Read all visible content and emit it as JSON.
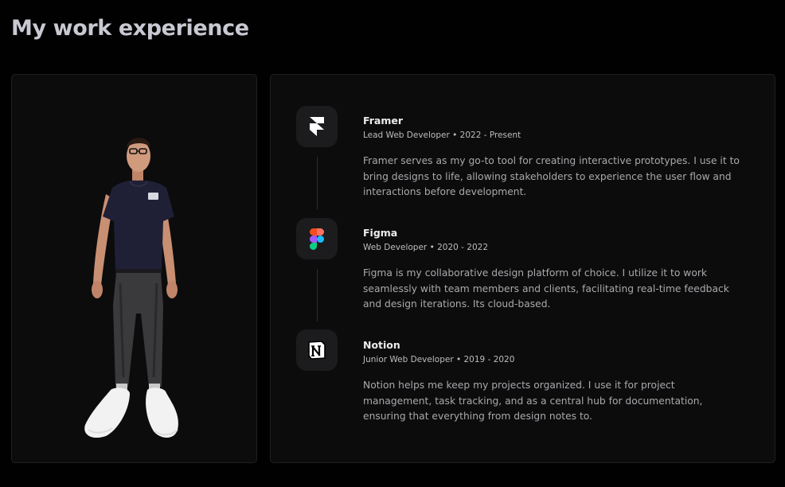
{
  "page": {
    "title": "My work experience"
  },
  "experience": [
    {
      "name": "Framer",
      "meta": "Lead Web Developer • 2022 - Present",
      "description": "Framer serves as my go-to tool for creating interactive prototypes. I use it to bring designs to life, allowing stakeholders to experience the user flow and interactions before development.",
      "icon": "framer-icon"
    },
    {
      "name": "Figma",
      "meta": "Web Developer • 2020 - 2022",
      "description": "Figma is my collaborative design platform of choice. I utilize it to work seamlessly with team members and clients, facilitating real-time feedback and design iterations. Its cloud-based.",
      "icon": "figma-icon"
    },
    {
      "name": "Notion",
      "meta": "Junior Web Developer • 2019 - 2020",
      "description": "Notion helps me keep my projects organized. I use it for project management, task tracking, and as a central hub for documentation, ensuring that everything from design notes to.",
      "icon": "notion-icon"
    }
  ],
  "colors": {
    "background": "#010101",
    "card": "#0c0c0d",
    "icon_tile": "#1c1c1e",
    "title": "#c9c9d3"
  }
}
